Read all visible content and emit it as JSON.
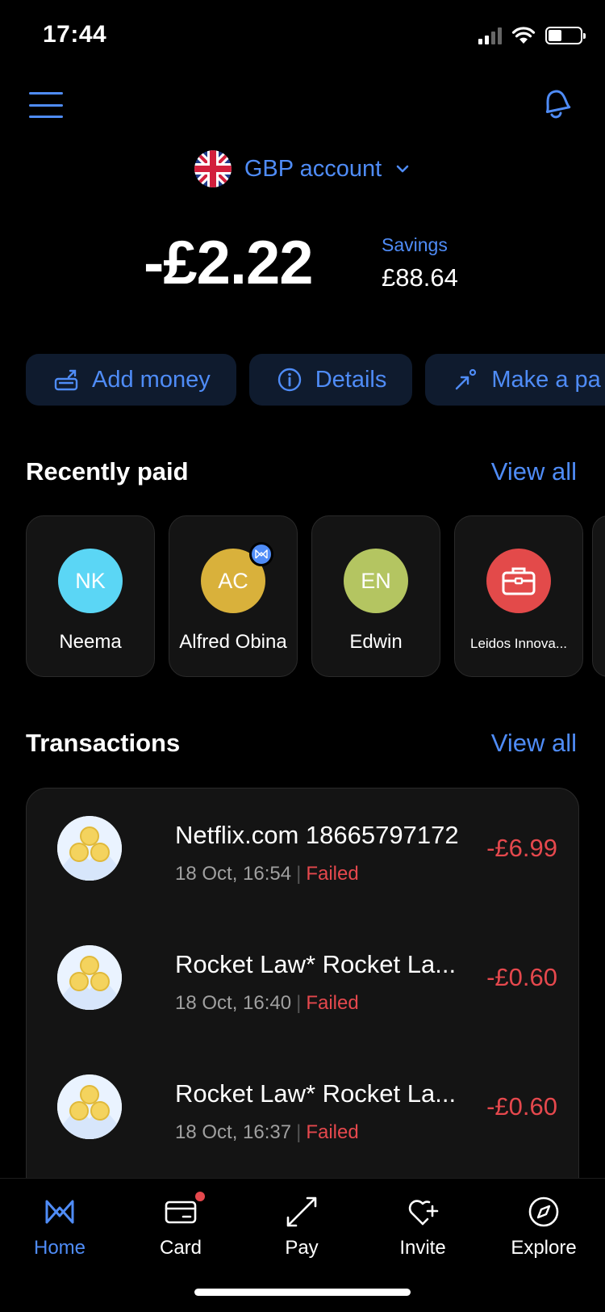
{
  "status_bar": {
    "time": "17:44"
  },
  "header": {
    "account_label": "GBP account"
  },
  "balance": {
    "main": "-£2.22",
    "savings_label": "Savings",
    "savings_value": "£88.64"
  },
  "actions": [
    {
      "label": "Add money",
      "icon": "add-money-icon"
    },
    {
      "label": "Details",
      "icon": "info-icon"
    },
    {
      "label": "Make a pa",
      "icon": "send-arrow-icon"
    }
  ],
  "recently_paid": {
    "title": "Recently paid",
    "view_all": "View all",
    "contacts": [
      {
        "initials": "NK",
        "name": "Neema",
        "color": "#5bd6f5"
      },
      {
        "initials": "AC",
        "name": "Alfred Obina",
        "color": "#d9b13b"
      },
      {
        "initials": "EN",
        "name": "Edwin",
        "color": "#b4c561"
      },
      {
        "initials": "",
        "name": "Leidos Innova...",
        "color": "#e34a4a",
        "icon": "briefcase-icon"
      }
    ]
  },
  "transactions": {
    "title": "Transactions",
    "view_all": "View all",
    "items": [
      {
        "title": "Netflix.com 18665797172",
        "date": "18 Oct, 16:54",
        "status": "Failed",
        "amount": "-£6.99"
      },
      {
        "title": "Rocket Law* Rocket La...",
        "date": "18 Oct, 16:40",
        "status": "Failed",
        "amount": "-£0.60"
      },
      {
        "title": "Rocket Law* Rocket La...",
        "date": "18 Oct, 16:37",
        "status": "Failed",
        "amount": "-£0.60"
      }
    ]
  },
  "bottom_nav": {
    "items": [
      {
        "label": "Home",
        "icon": "home-logo-icon"
      },
      {
        "label": "Card",
        "icon": "card-icon"
      },
      {
        "label": "Pay",
        "icon": "pay-arrows-icon"
      },
      {
        "label": "Invite",
        "icon": "heart-plus-icon"
      },
      {
        "label": "Explore",
        "icon": "compass-icon"
      }
    ]
  },
  "colors": {
    "accent": "#4f8cf7",
    "negative": "#e5484d",
    "background": "#000000",
    "card": "#141414"
  }
}
